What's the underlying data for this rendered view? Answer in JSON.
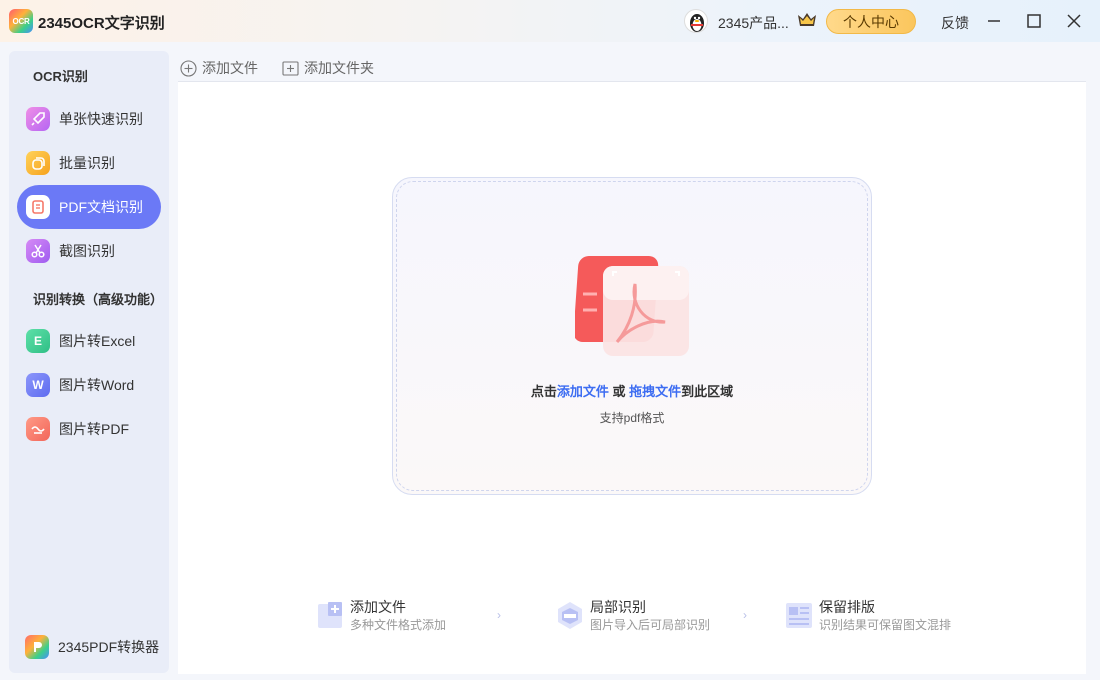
{
  "app": {
    "logo_text": "OCR",
    "title": "2345OCR文字识别"
  },
  "header": {
    "user_name": "2345产品...",
    "center_button": "个人中心",
    "feedback": "反馈"
  },
  "sidebar": {
    "section1": "OCR识别",
    "items1": [
      {
        "label": "单张快速识别",
        "icon": "rocket-icon",
        "color": "#e27cf0"
      },
      {
        "label": "批量识别",
        "icon": "batch-icon",
        "color": "#f7b731"
      },
      {
        "label": "PDF文档识别",
        "icon": "pdf-doc-icon",
        "color": "#ffffff"
      },
      {
        "label": "截图识别",
        "icon": "scissors-icon",
        "color": "#b867f0"
      }
    ],
    "section2": "识别转换（高级功能）",
    "items2": [
      {
        "label": "图片转Excel",
        "icon": "excel-icon",
        "glyph": "E",
        "color": "#3cc993"
      },
      {
        "label": "图片转Word",
        "icon": "word-icon",
        "glyph": "W",
        "color": "#6c7bf5"
      },
      {
        "label": "图片转PDF",
        "icon": "image-pdf-icon",
        "color": "#f5796a"
      }
    ],
    "bottom_app": "2345PDF转换器"
  },
  "toolbar": {
    "add_file": "添加文件",
    "add_folder": "添加文件夹"
  },
  "dropzone": {
    "prefix": "点击",
    "link1": "添加文件",
    "middle": " 或 ",
    "link2": "拖拽文件",
    "suffix": "到此区域",
    "sub": "支持pdf格式"
  },
  "features": [
    {
      "title": "添加文件",
      "desc": "多种文件格式添加",
      "icon": "add-file-icon"
    },
    {
      "title": "局部识别",
      "desc": "图片导入后可局部识别",
      "icon": "partial-recognition-icon"
    },
    {
      "title": "保留排版",
      "desc": "识别结果可保留图文混排",
      "icon": "keep-layout-icon"
    }
  ],
  "colors": {
    "accent": "#6b79f6",
    "link": "#3d6df2",
    "gold": "#fbc65d"
  }
}
